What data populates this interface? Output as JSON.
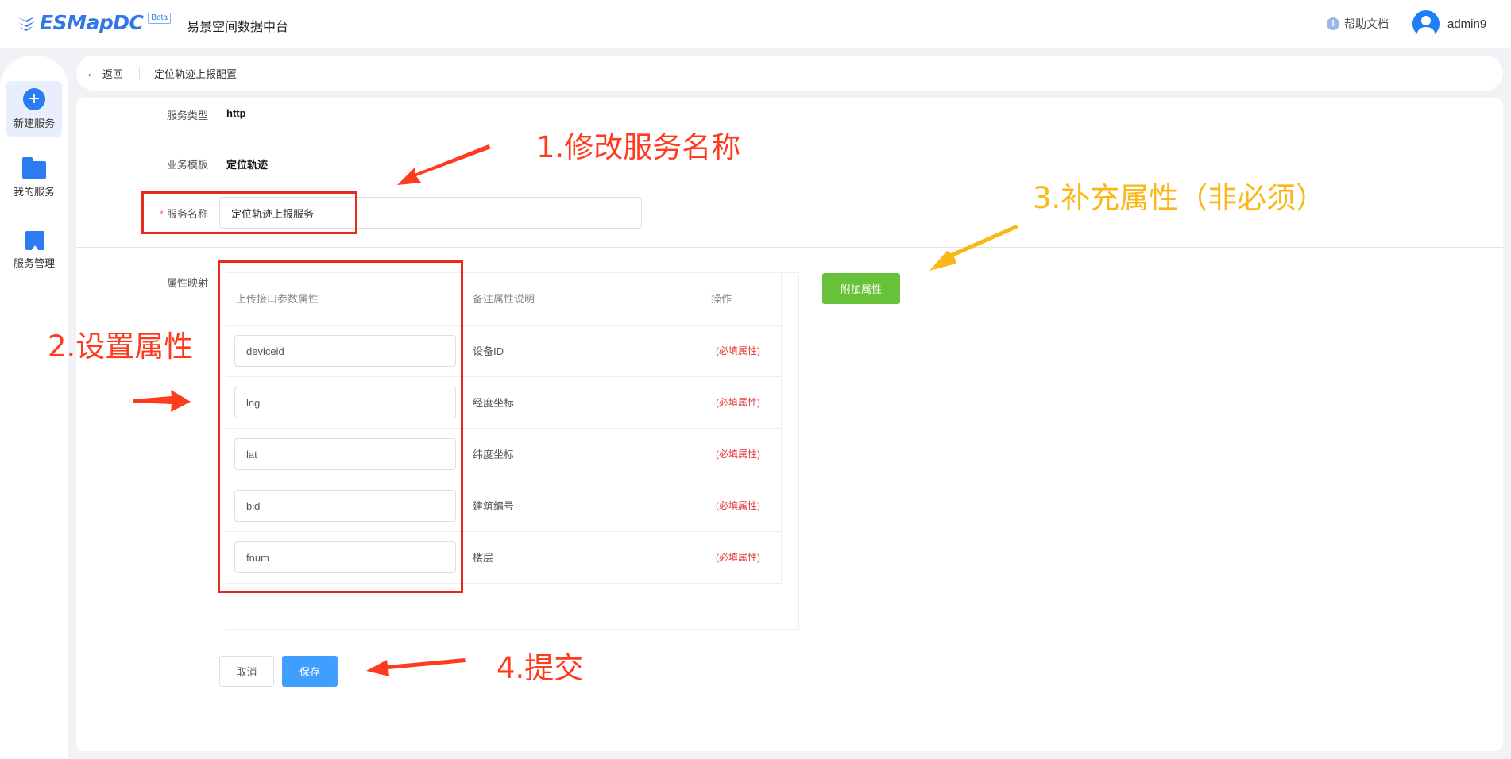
{
  "header": {
    "logo_text": "ESMapDC",
    "beta_badge": "Beta",
    "app_name": "易景空间数据中台",
    "help_label": "帮助文档",
    "user_name": "admin9"
  },
  "sidebar": {
    "items": [
      {
        "label": "新建服务",
        "icon": "plus-circle-icon"
      },
      {
        "label": "我的服务",
        "icon": "folder-icon"
      },
      {
        "label": "服务管理",
        "icon": "bookmark-icon"
      }
    ]
  },
  "breadcrumb": {
    "back_label": "返回",
    "page_title": "定位轨迹上报配置"
  },
  "form": {
    "service_type_label": "服务类型",
    "service_type_value": "http",
    "template_label": "业务模板",
    "template_value": "定位轨迹",
    "required_mark": "*",
    "service_name_label": "服务名称",
    "service_name_value": "定位轨迹上报服务",
    "mapping_label": "属性映射"
  },
  "table": {
    "headers": [
      "上传接口参数属性",
      "备注属性说明",
      "操作"
    ],
    "rows": [
      {
        "param": "deviceid",
        "desc": "设备ID",
        "op": "(必填属性)"
      },
      {
        "param": "lng",
        "desc": "经度坐标",
        "op": "(必填属性)"
      },
      {
        "param": "lat",
        "desc": "纬度坐标",
        "op": "(必填属性)"
      },
      {
        "param": "bid",
        "desc": "建筑编号",
        "op": "(必填属性)"
      },
      {
        "param": "fnum",
        "desc": "楼层",
        "op": "(必填属性)"
      }
    ]
  },
  "buttons": {
    "add_attribute": "附加属性",
    "cancel": "取消",
    "save": "保存"
  },
  "annotations": {
    "step1": "1.修改服务名称",
    "step2": "2.设置属性",
    "step3": "3.补充属性（非必须）",
    "step4": "4.提交"
  },
  "colors": {
    "brand": "#2f76e6",
    "annotation_red": "#ff3b1f",
    "annotation_orange": "#f9b817",
    "add_button": "#67c23a",
    "save_button": "#409eff"
  }
}
